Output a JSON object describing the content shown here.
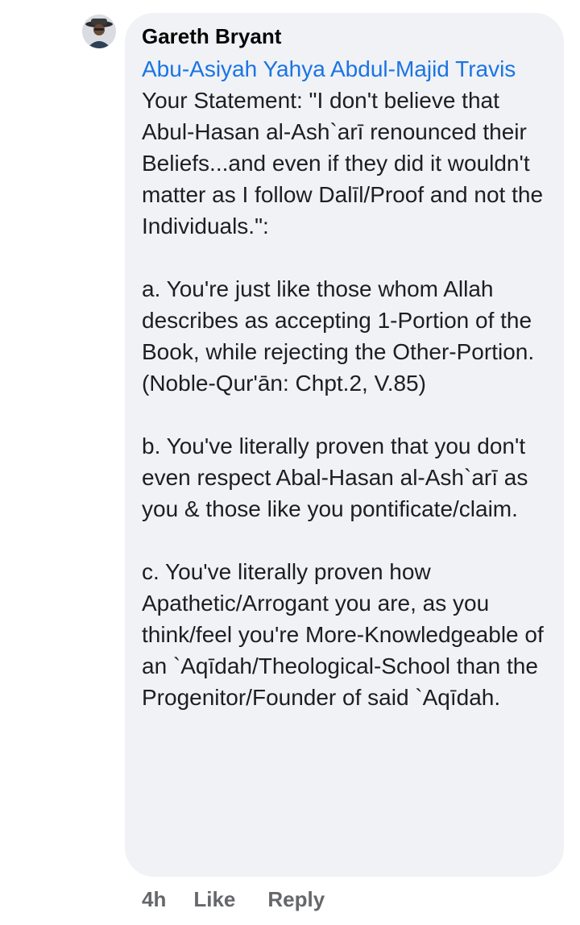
{
  "comment": {
    "author": "Gareth Bryant",
    "mention": "Abu-Asiyah Yahya Abdul-Majid Travis",
    "text": " Your Statement: \"I don't believe that Abul-Hasan al-Ash`arī renounced their Beliefs...and even if they did it wouldn't matter as I follow Dalīl/Proof and not the Individuals.\":\n\na. You're just like those whom Allah describes as accepting 1-Portion of the Book, while rejecting the Other-Portion.\n(Noble-Qur'ān: Chpt.2, V.85)\n\nb. You've literally proven that you don't even respect Abal-Hasan al-Ash`arī as you & those like you pontificate/claim.\n\nc. You've literally proven how Apathetic/Arrogant you are, as you think/feel you're More-Knowledgeable of an `Aqīdah/Theological-School than the Progenitor/Founder of said `Aqīdah."
  },
  "actions": {
    "time": "4h",
    "like": "Like",
    "reply": "Reply"
  },
  "colors": {
    "bubble": "#f0f2f5",
    "mention": "#1b74e4",
    "meta": "#65676b"
  }
}
